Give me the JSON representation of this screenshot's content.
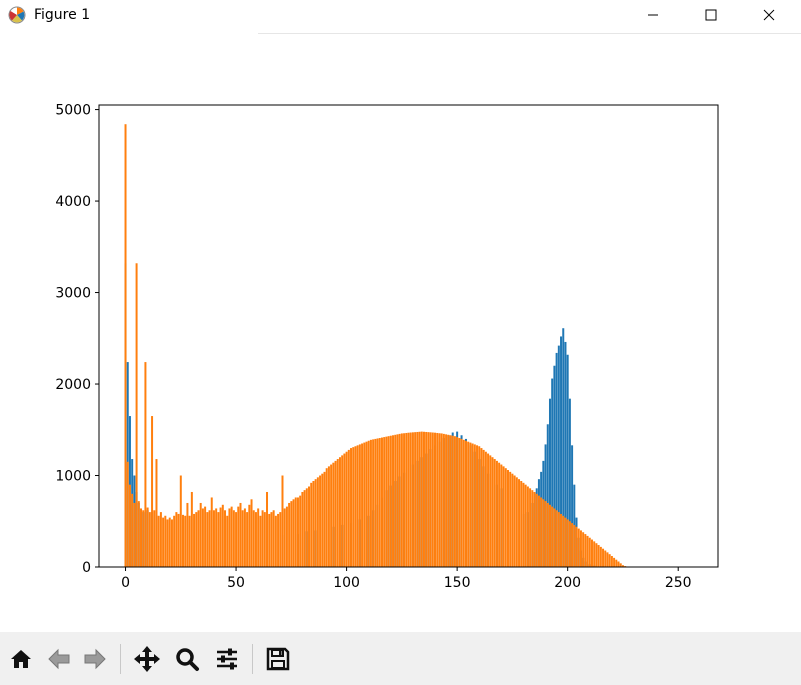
{
  "window": {
    "title": "Figure 1"
  },
  "toolbar": {
    "buttons": [
      {
        "icon": "home-icon"
      },
      {
        "icon": "back-arrow-icon"
      },
      {
        "icon": "forward-arrow-icon"
      },
      {
        "icon": "pan-icon"
      },
      {
        "icon": "zoom-icon"
      },
      {
        "icon": "configure-subplots-icon"
      },
      {
        "icon": "save-icon"
      }
    ]
  },
  "chart_data": {
    "type": "bar",
    "title": "",
    "xlabel": "",
    "ylabel": "",
    "xlim": [
      -12,
      268
    ],
    "ylim": [
      0,
      5050
    ],
    "xticks": [
      0,
      50,
      100,
      150,
      200,
      250
    ],
    "yticks": [
      0,
      1000,
      2000,
      3000,
      4000,
      5000
    ],
    "grid": false,
    "colors": {
      "series1": "#1f77b4",
      "series2": "#ff7f0e"
    },
    "series": [
      {
        "color": "#1f77b4",
        "points": [
          [
            0,
            3320
          ],
          [
            1,
            2240
          ],
          [
            2,
            1650
          ],
          [
            3,
            1180
          ],
          [
            4,
            1000
          ],
          [
            5,
            820
          ],
          [
            6,
            700
          ],
          [
            8,
            600
          ],
          [
            10,
            620
          ],
          [
            12,
            600
          ],
          [
            14,
            570
          ],
          [
            71,
            350
          ],
          [
            78,
            360
          ],
          [
            82,
            390
          ],
          [
            86,
            400
          ],
          [
            90,
            420
          ],
          [
            94,
            440
          ],
          [
            98,
            460
          ],
          [
            102,
            480
          ],
          [
            106,
            520
          ],
          [
            110,
            560
          ],
          [
            112,
            620
          ],
          [
            114,
            680
          ],
          [
            116,
            760
          ],
          [
            118,
            840
          ],
          [
            120,
            890
          ],
          [
            122,
            940
          ],
          [
            124,
            990
          ],
          [
            126,
            1030
          ],
          [
            128,
            1080
          ],
          [
            130,
            1120
          ],
          [
            132,
            1160
          ],
          [
            134,
            1200
          ],
          [
            136,
            1240
          ],
          [
            138,
            1290
          ],
          [
            140,
            1330
          ],
          [
            142,
            1370
          ],
          [
            144,
            1410
          ],
          [
            146,
            1440
          ],
          [
            148,
            1470
          ],
          [
            150,
            1480
          ],
          [
            152,
            1440
          ],
          [
            154,
            1400
          ],
          [
            156,
            1330
          ],
          [
            158,
            1260
          ],
          [
            160,
            1180
          ],
          [
            162,
            1100
          ],
          [
            164,
            1020
          ],
          [
            166,
            960
          ],
          [
            168,
            900
          ],
          [
            170,
            860
          ],
          [
            180,
            580
          ],
          [
            182,
            600
          ],
          [
            184,
            700
          ],
          [
            186,
            860
          ],
          [
            187,
            960
          ],
          [
            188,
            1040
          ],
          [
            189,
            1160
          ],
          [
            190,
            1340
          ],
          [
            191,
            1560
          ],
          [
            192,
            1840
          ],
          [
            193,
            2060
          ],
          [
            194,
            2200
          ],
          [
            195,
            2340
          ],
          [
            196,
            2420
          ],
          [
            197,
            2520
          ],
          [
            198,
            2610
          ],
          [
            199,
            2460
          ],
          [
            200,
            2320
          ],
          [
            201,
            1840
          ],
          [
            202,
            1330
          ],
          [
            203,
            900
          ],
          [
            204,
            540
          ],
          [
            205,
            320
          ],
          [
            206,
            180
          ],
          [
            207,
            100
          ],
          [
            208,
            60
          ],
          [
            210,
            30
          ],
          [
            212,
            15
          ]
        ]
      },
      {
        "color": "#ff7f0e",
        "points": [
          [
            0,
            4840
          ],
          [
            1,
            1150
          ],
          [
            2,
            900
          ],
          [
            3,
            800
          ],
          [
            4,
            700
          ],
          [
            5,
            3320
          ],
          [
            6,
            720
          ],
          [
            7,
            640
          ],
          [
            8,
            620
          ],
          [
            9,
            2240
          ],
          [
            10,
            650
          ],
          [
            11,
            600
          ],
          [
            12,
            1650
          ],
          [
            13,
            620
          ],
          [
            14,
            1180
          ],
          [
            15,
            560
          ],
          [
            16,
            600
          ],
          [
            17,
            540
          ],
          [
            18,
            560
          ],
          [
            19,
            520
          ],
          [
            20,
            540
          ],
          [
            21,
            520
          ],
          [
            22,
            560
          ],
          [
            23,
            600
          ],
          [
            24,
            580
          ],
          [
            25,
            1000
          ],
          [
            26,
            570
          ],
          [
            27,
            560
          ],
          [
            28,
            700
          ],
          [
            29,
            560
          ],
          [
            30,
            820
          ],
          [
            31,
            580
          ],
          [
            32,
            600
          ],
          [
            33,
            620
          ],
          [
            34,
            700
          ],
          [
            35,
            640
          ],
          [
            36,
            660
          ],
          [
            37,
            600
          ],
          [
            38,
            620
          ],
          [
            39,
            760
          ],
          [
            40,
            620
          ],
          [
            41,
            640
          ],
          [
            42,
            600
          ],
          [
            43,
            650
          ],
          [
            44,
            680
          ],
          [
            45,
            620
          ],
          [
            46,
            560
          ],
          [
            47,
            640
          ],
          [
            48,
            660
          ],
          [
            49,
            620
          ],
          [
            50,
            600
          ],
          [
            51,
            660
          ],
          [
            52,
            700
          ],
          [
            53,
            620
          ],
          [
            54,
            640
          ],
          [
            55,
            600
          ],
          [
            56,
            680
          ],
          [
            57,
            740
          ],
          [
            58,
            620
          ],
          [
            59,
            600
          ],
          [
            60,
            640
          ],
          [
            61,
            560
          ],
          [
            62,
            620
          ],
          [
            63,
            600
          ],
          [
            64,
            820
          ],
          [
            65,
            580
          ],
          [
            66,
            600
          ],
          [
            67,
            620
          ],
          [
            68,
            560
          ],
          [
            69,
            580
          ],
          [
            70,
            600
          ],
          [
            71,
            1000
          ],
          [
            72,
            640
          ],
          [
            73,
            660
          ],
          [
            74,
            700
          ],
          [
            75,
            720
          ],
          [
            76,
            740
          ],
          [
            77,
            760
          ],
          [
            78,
            760
          ],
          [
            79,
            780
          ],
          [
            80,
            820
          ],
          [
            81,
            840
          ],
          [
            82,
            860
          ],
          [
            83,
            880
          ],
          [
            84,
            920
          ],
          [
            85,
            940
          ],
          [
            86,
            960
          ],
          [
            87,
            980
          ],
          [
            88,
            1000
          ],
          [
            89,
            1020
          ],
          [
            90,
            1040
          ],
          [
            91,
            1080
          ],
          [
            92,
            1100
          ],
          [
            93,
            1120
          ],
          [
            94,
            1140
          ],
          [
            95,
            1160
          ],
          [
            96,
            1180
          ],
          [
            97,
            1200
          ],
          [
            98,
            1220
          ],
          [
            99,
            1240
          ],
          [
            100,
            1260
          ],
          [
            101,
            1280
          ],
          [
            102,
            1300
          ],
          [
            103,
            1310
          ],
          [
            104,
            1320
          ],
          [
            105,
            1330
          ],
          [
            106,
            1340
          ],
          [
            107,
            1350
          ],
          [
            108,
            1360
          ],
          [
            109,
            1370
          ],
          [
            110,
            1380
          ],
          [
            111,
            1390
          ],
          [
            112,
            1395
          ],
          [
            113,
            1400
          ],
          [
            114,
            1405
          ],
          [
            115,
            1410
          ],
          [
            116,
            1415
          ],
          [
            117,
            1420
          ],
          [
            118,
            1425
          ],
          [
            119,
            1430
          ],
          [
            120,
            1435
          ],
          [
            121,
            1440
          ],
          [
            122,
            1445
          ],
          [
            123,
            1450
          ],
          [
            124,
            1455
          ],
          [
            125,
            1460
          ],
          [
            126,
            1462
          ],
          [
            127,
            1465
          ],
          [
            128,
            1468
          ],
          [
            129,
            1470
          ],
          [
            130,
            1472
          ],
          [
            131,
            1474
          ],
          [
            132,
            1476
          ],
          [
            133,
            1478
          ],
          [
            134,
            1480
          ],
          [
            135,
            1478
          ],
          [
            136,
            1476
          ],
          [
            137,
            1474
          ],
          [
            138,
            1472
          ],
          [
            139,
            1470
          ],
          [
            140,
            1468
          ],
          [
            141,
            1465
          ],
          [
            142,
            1462
          ],
          [
            143,
            1460
          ],
          [
            144,
            1455
          ],
          [
            145,
            1450
          ],
          [
            146,
            1445
          ],
          [
            147,
            1440
          ],
          [
            148,
            1435
          ],
          [
            149,
            1430
          ],
          [
            150,
            1420
          ],
          [
            151,
            1410
          ],
          [
            152,
            1400
          ],
          [
            153,
            1390
          ],
          [
            154,
            1380
          ],
          [
            155,
            1370
          ],
          [
            156,
            1360
          ],
          [
            157,
            1350
          ],
          [
            158,
            1340
          ],
          [
            159,
            1330
          ],
          [
            160,
            1320
          ],
          [
            161,
            1300
          ],
          [
            162,
            1280
          ],
          [
            163,
            1260
          ],
          [
            164,
            1240
          ],
          [
            165,
            1220
          ],
          [
            166,
            1200
          ],
          [
            167,
            1180
          ],
          [
            168,
            1160
          ],
          [
            169,
            1140
          ],
          [
            170,
            1120
          ],
          [
            171,
            1100
          ],
          [
            172,
            1080
          ],
          [
            173,
            1060
          ],
          [
            174,
            1040
          ],
          [
            175,
            1020
          ],
          [
            176,
            1000
          ],
          [
            177,
            980
          ],
          [
            178,
            960
          ],
          [
            179,
            940
          ],
          [
            180,
            920
          ],
          [
            181,
            900
          ],
          [
            182,
            880
          ],
          [
            183,
            860
          ],
          [
            184,
            840
          ],
          [
            185,
            820
          ],
          [
            186,
            800
          ],
          [
            187,
            780
          ],
          [
            188,
            760
          ],
          [
            189,
            740
          ],
          [
            190,
            720
          ],
          [
            191,
            700
          ],
          [
            192,
            680
          ],
          [
            193,
            660
          ],
          [
            194,
            640
          ],
          [
            195,
            620
          ],
          [
            196,
            600
          ],
          [
            197,
            580
          ],
          [
            198,
            560
          ],
          [
            199,
            540
          ],
          [
            200,
            520
          ],
          [
            201,
            500
          ],
          [
            202,
            480
          ],
          [
            203,
            460
          ],
          [
            204,
            440
          ],
          [
            205,
            420
          ],
          [
            206,
            400
          ],
          [
            207,
            380
          ],
          [
            208,
            360
          ],
          [
            209,
            340
          ],
          [
            210,
            320
          ],
          [
            211,
            300
          ],
          [
            212,
            280
          ],
          [
            213,
            260
          ],
          [
            214,
            240
          ],
          [
            215,
            220
          ],
          [
            216,
            200
          ],
          [
            217,
            180
          ],
          [
            218,
            160
          ],
          [
            219,
            140
          ],
          [
            220,
            120
          ],
          [
            221,
            100
          ],
          [
            222,
            80
          ],
          [
            223,
            60
          ],
          [
            224,
            40
          ],
          [
            225,
            20
          ],
          [
            226,
            10
          ],
          [
            227,
            5
          ],
          [
            228,
            0
          ]
        ]
      }
    ]
  }
}
